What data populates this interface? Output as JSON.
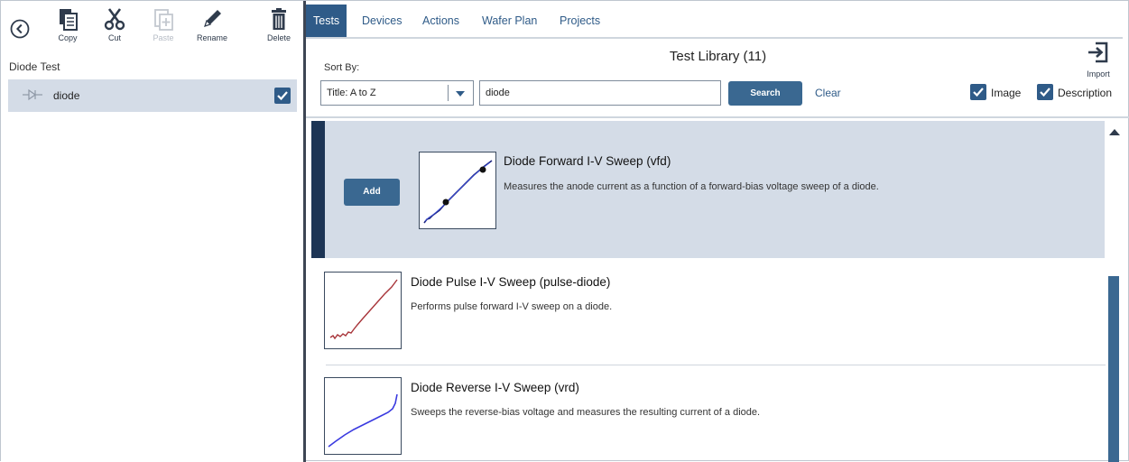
{
  "toolbar": {
    "copy_label": "Copy",
    "cut_label": "Cut",
    "paste_label": "Paste",
    "rename_label": "Rename",
    "delete_label": "Delete"
  },
  "left_panel": {
    "title": "Diode Test",
    "items": [
      {
        "label": "diode",
        "checked": true
      }
    ]
  },
  "tabs": [
    {
      "label": "Tests",
      "active": true
    },
    {
      "label": "Devices"
    },
    {
      "label": "Actions"
    },
    {
      "label": "Wafer Plan"
    },
    {
      "label": "Projects"
    }
  ],
  "library": {
    "title": "Test Library (11)",
    "import_label": "Import",
    "sort_label": "Sort By:",
    "sort_value": "Title: A to Z",
    "search_value": "diode",
    "search_button": "Search",
    "clear_link": "Clear",
    "image_label": "Image",
    "image_checked": true,
    "description_label": "Description",
    "description_checked": true,
    "add_button": "Add"
  },
  "results": [
    {
      "title": "Diode Forward I-V Sweep (vfd)",
      "description": "Measures the anode current as a function of a forward-bias voltage sweep of a diode.",
      "selected": true
    },
    {
      "title": "Diode Pulse I-V Sweep (pulse-diode)",
      "description": "Performs pulse forward I-V sweep on a diode."
    },
    {
      "title": "Diode Reverse I-V Sweep (vrd)",
      "description": "Sweeps the reverse-bias voltage and measures the resulting current of a diode."
    }
  ],
  "colors": {
    "accent": "#2f5b88",
    "selected_row": "#d4dce7",
    "selection_bar": "#1d3555",
    "thumb_forward": "#2233cc",
    "thumb_pulse": "#a8353a",
    "thumb_reverse": "#3a3ae0"
  },
  "icons": {
    "back": "chevron-left-circle-icon",
    "copy": "copy-icon",
    "cut": "scissors-icon",
    "paste": "paste-icon",
    "rename": "pencil-icon",
    "delete": "trash-icon",
    "import": "import-icon",
    "tree_item": "diode-icon",
    "sort_arrow": "chevron-down-icon",
    "scroll_up": "triangle-up-icon"
  }
}
